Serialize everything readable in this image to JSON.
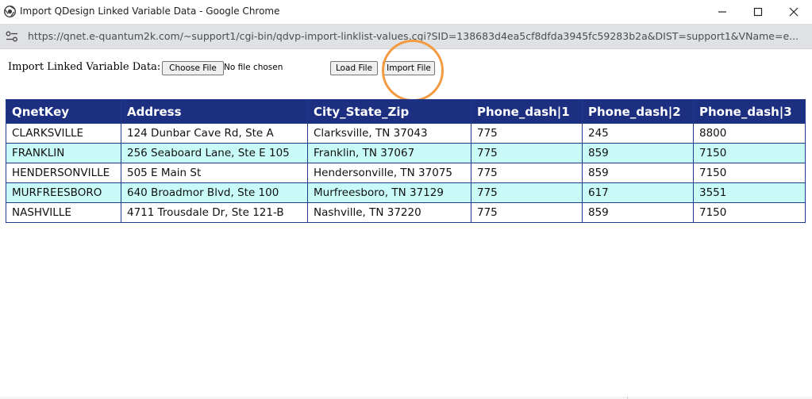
{
  "window": {
    "title": "Import QDesign Linked Variable Data - Google Chrome"
  },
  "address_bar": {
    "url": "https://qnet.e-quantum2k.com/~support1/cgi-bin/qdvp-import-linklist-values.cgi?SID=138683d4ea5cf8dfda3945fc59283b2a&DIST=support1&VName=e..."
  },
  "import_form": {
    "label": "Import Linked Variable Data:",
    "choose_file_label": "Choose File",
    "no_file_text": "No file chosen",
    "load_file_label": "Load File",
    "import_file_label": "Import File"
  },
  "table": {
    "columns": [
      "QnetKey",
      "Address",
      "City_State_Zip",
      "Phone_dash|1",
      "Phone_dash|2",
      "Phone_dash|3"
    ],
    "rows": [
      [
        "CLARKSVILLE",
        "124 Dunbar Cave Rd, Ste A",
        "Clarksville, TN 37043",
        "775",
        "245",
        "8800"
      ],
      [
        "FRANKLIN",
        "256 Seaboard Lane, Ste E 105",
        "Franklin, TN 37067",
        "775",
        "859",
        "7150"
      ],
      [
        "HENDERSONVILLE",
        "505 E Main St",
        "Hendersonville, TN 37075",
        "775",
        "859",
        "7150"
      ],
      [
        "MURFREESBORO",
        "640 Broadmor Blvd, Ste 100",
        "Murfreesboro, TN 37129",
        "775",
        "617",
        "3551"
      ],
      [
        "NASHVILLE",
        "4711 Trousdale Dr, Ste 121-B",
        "Nashville, TN 37220",
        "775",
        "859",
        "7150"
      ]
    ]
  },
  "colors": {
    "header_bg": "#1c2f80",
    "row_alt_bg": "#c8fbf7",
    "highlight": "#f39a3e"
  },
  "icons": {
    "app": "chrome-icon",
    "site": "site-settings-icon",
    "minimize": "minimize-icon",
    "maximize": "maximize-icon",
    "close": "close-icon"
  }
}
